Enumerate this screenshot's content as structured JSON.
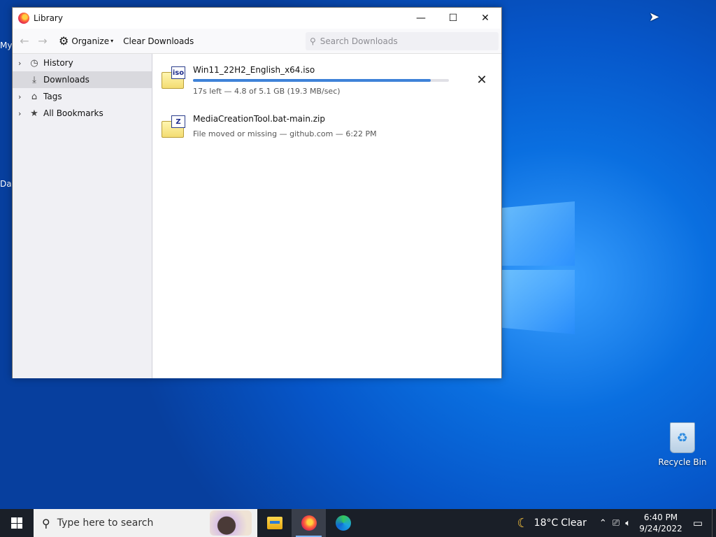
{
  "desktop": {
    "edge_labels": [
      "My",
      "Da"
    ],
    "recycle_bin_label": "Recycle Bin"
  },
  "window": {
    "title": "Library",
    "controls": {
      "minimize": "—",
      "maximize": "☐",
      "close": "✕"
    }
  },
  "toolbar": {
    "organize_label": "Organize",
    "clear_downloads_label": "Clear Downloads",
    "search_placeholder": "Search Downloads"
  },
  "sidebar": {
    "items": [
      {
        "label": "History",
        "icon": "clock-icon",
        "has_twisty": true,
        "selected": false
      },
      {
        "label": "Downloads",
        "icon": "download-icon",
        "has_twisty": false,
        "selected": true
      },
      {
        "label": "Tags",
        "icon": "tag-icon",
        "has_twisty": true,
        "selected": false
      },
      {
        "label": "All Bookmarks",
        "icon": "star-icon",
        "has_twisty": true,
        "selected": false
      }
    ]
  },
  "downloads": [
    {
      "name": "Win11_22H2_English_x64.iso",
      "badge": "iso",
      "status": "17s left — 4.8 of 5.1 GB (19.3 MB/sec)",
      "progress_fraction": 0.93,
      "in_progress": true
    },
    {
      "name": "MediaCreationTool.bat-main.zip",
      "badge": "Z",
      "status": "File moved or missing — github.com — 6:22 PM",
      "in_progress": false
    }
  ],
  "taskbar": {
    "search_placeholder": "Type here to search",
    "weather_temp": "18°C",
    "weather_cond": "Clear",
    "time": "6:40 PM",
    "date": "9/24/2022"
  },
  "colors": {
    "accent": "#3f82d8",
    "desktop_blue": "#0a6fe0",
    "taskbar": "#1a1f28"
  }
}
